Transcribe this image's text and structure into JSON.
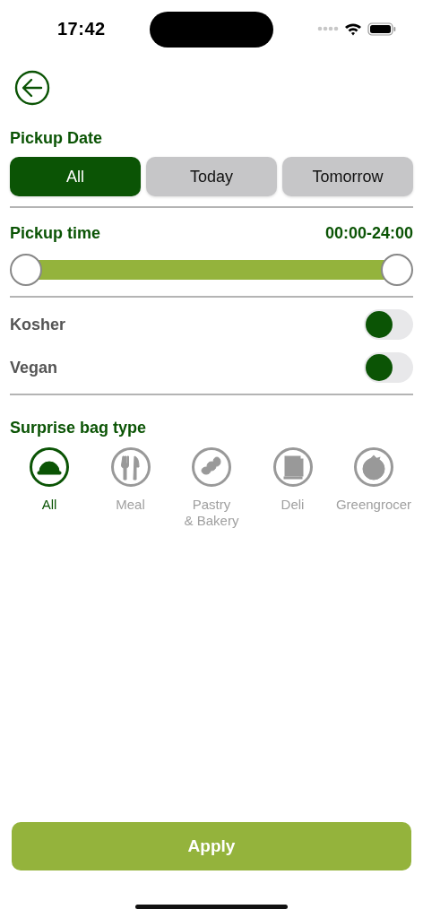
{
  "status_bar": {
    "time": "17:42"
  },
  "pickup_date": {
    "title": "Pickup Date",
    "options": [
      {
        "label": "All",
        "selected": true
      },
      {
        "label": "Today",
        "selected": false
      },
      {
        "label": "Tomorrow",
        "selected": false
      }
    ]
  },
  "pickup_time": {
    "title": "Pickup time",
    "reading": "00:00-24:00",
    "thumbs": [
      {
        "level": 0
      },
      {
        "level": 1
      }
    ]
  },
  "toggles": [
    {
      "label": "Kosher",
      "on": false
    },
    {
      "label": "Vegan",
      "on": false
    }
  ],
  "bag_type": {
    "title": "Surprise bag type",
    "items": [
      {
        "kind": "all",
        "label": "All",
        "selected": true
      },
      {
        "kind": "meal",
        "label": "Meal",
        "selected": false
      },
      {
        "kind": "pastry",
        "label": "Pastry\n& Bakery",
        "selected": false
      },
      {
        "kind": "deli",
        "label": "Deli",
        "selected": false
      },
      {
        "kind": "greengrocer",
        "label": "Greengrocer",
        "selected": false
      }
    ]
  },
  "apply_button": "Apply"
}
